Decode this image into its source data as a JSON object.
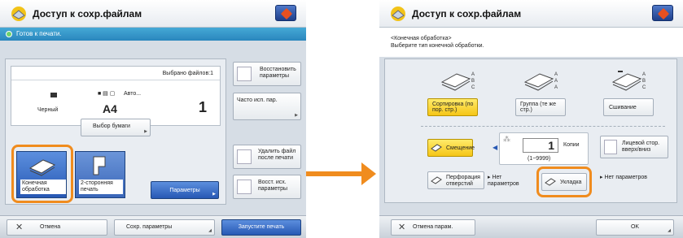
{
  "left": {
    "title": "Доступ к сохр.файлам",
    "status": "Готов к печати.",
    "files_selected": "Выбрано файлов:1",
    "color_label": "Черный",
    "paper_auto": "Авто...",
    "paper_size": "A4",
    "copies": "1",
    "paper_select_btn": "Выбор бумаги",
    "restore_params": "Восстановить параметры",
    "frequent_params": "Часто исп. пар.",
    "delete_after_print": "Удалить файл после печати",
    "restore_out_params": "Восст. исх. параметры",
    "finishing": "Конечная обработка",
    "duplex": "2-сторонняя печать",
    "params": "Параметры",
    "cancel": "Отмена",
    "save_params": "Сохр. параметры",
    "start_print": "Запустите печать"
  },
  "right": {
    "title": "Доступ к сохр.файлам",
    "header_line1": "<Конечная обработка>",
    "header_line2": "Выберите тип конечной обработки.",
    "collate": "Сортировка (по пор. стр.)",
    "group": "Группа (те же стр.)",
    "staple": "Сшивание",
    "offset": "Смещение",
    "copies": "1",
    "copies_label": "Копии",
    "copies_range": "(1~9999)",
    "face_updown": "Лицевой стор. вверх/вниз",
    "punch": "Перфорация отверстий",
    "punch_value": "Нет параметров",
    "folding": "Укладка",
    "folding_value": "Нет параметров",
    "cancel_settings": "Отмена парам.",
    "ok": "OK"
  },
  "colors": {
    "accent": "#f08c1e",
    "blue": "#2758b4",
    "status": "#3498cc"
  }
}
